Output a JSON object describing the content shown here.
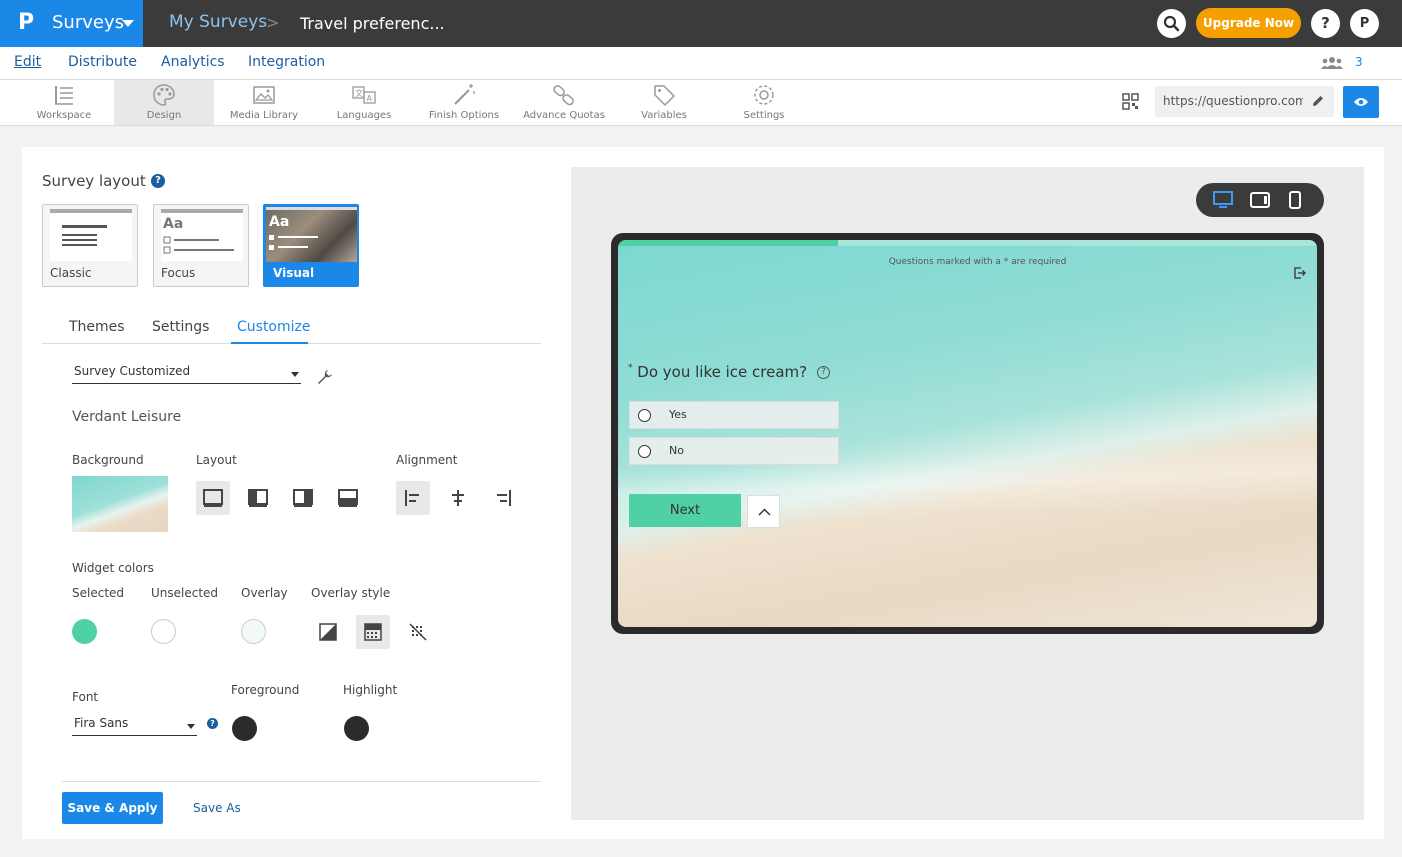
{
  "topbar": {
    "logo": "P",
    "app_name": "Surveys",
    "breadcrumb_root": "My Surveys",
    "breadcrumb_sep": ">",
    "survey_title": "Travel preferenc...",
    "upgrade_label": "Upgrade Now",
    "help_label": "?",
    "user_initial": "P"
  },
  "subnav": {
    "items": [
      "Edit",
      "Distribute",
      "Analytics",
      "Integration"
    ],
    "collaborators_count": "3"
  },
  "toolbar": {
    "tools": [
      "Workspace",
      "Design",
      "Media Library",
      "Languages",
      "Finish Options",
      "Advance Quotas",
      "Variables",
      "Settings"
    ],
    "active_tool": "Design",
    "url": "https://questionpro.com/"
  },
  "design": {
    "survey_layout_heading": "Survey layout",
    "help_mark": "?",
    "layouts": [
      "Classic",
      "Focus",
      "Visual"
    ],
    "selected_layout": "Visual",
    "thumb_text": "Aa",
    "tabs": [
      "Themes",
      "Settings",
      "Customize"
    ],
    "active_tab": "Customize",
    "theme_select_value": "Survey Customized",
    "theme_name": "Verdant Leisure",
    "background_label": "Background",
    "layout_label": "Layout",
    "alignment_label": "Alignment",
    "widget_colors_label": "Widget colors",
    "selected_label": "Selected",
    "unselected_label": "Unselected",
    "overlay_label": "Overlay",
    "overlay_style_label": "Overlay style",
    "font_label": "Font",
    "font_value": "Fira Sans",
    "foreground_label": "Foreground",
    "highlight_label": "Highlight",
    "save_apply_label": "Save & Apply",
    "save_as_label": "Save As",
    "colors": {
      "selected": "#4fd0a5",
      "unselected": "#ffffff",
      "overlay": "#f2faf8",
      "foreground": "#2b2b2b",
      "highlight": "#2b2b2b"
    }
  },
  "preview": {
    "required_note": "Questions marked with a * are required",
    "question_marker": "*",
    "question": "Do you like ice cream?",
    "question_help": "?",
    "options": [
      "Yes",
      "No"
    ],
    "next_label": "Next"
  }
}
